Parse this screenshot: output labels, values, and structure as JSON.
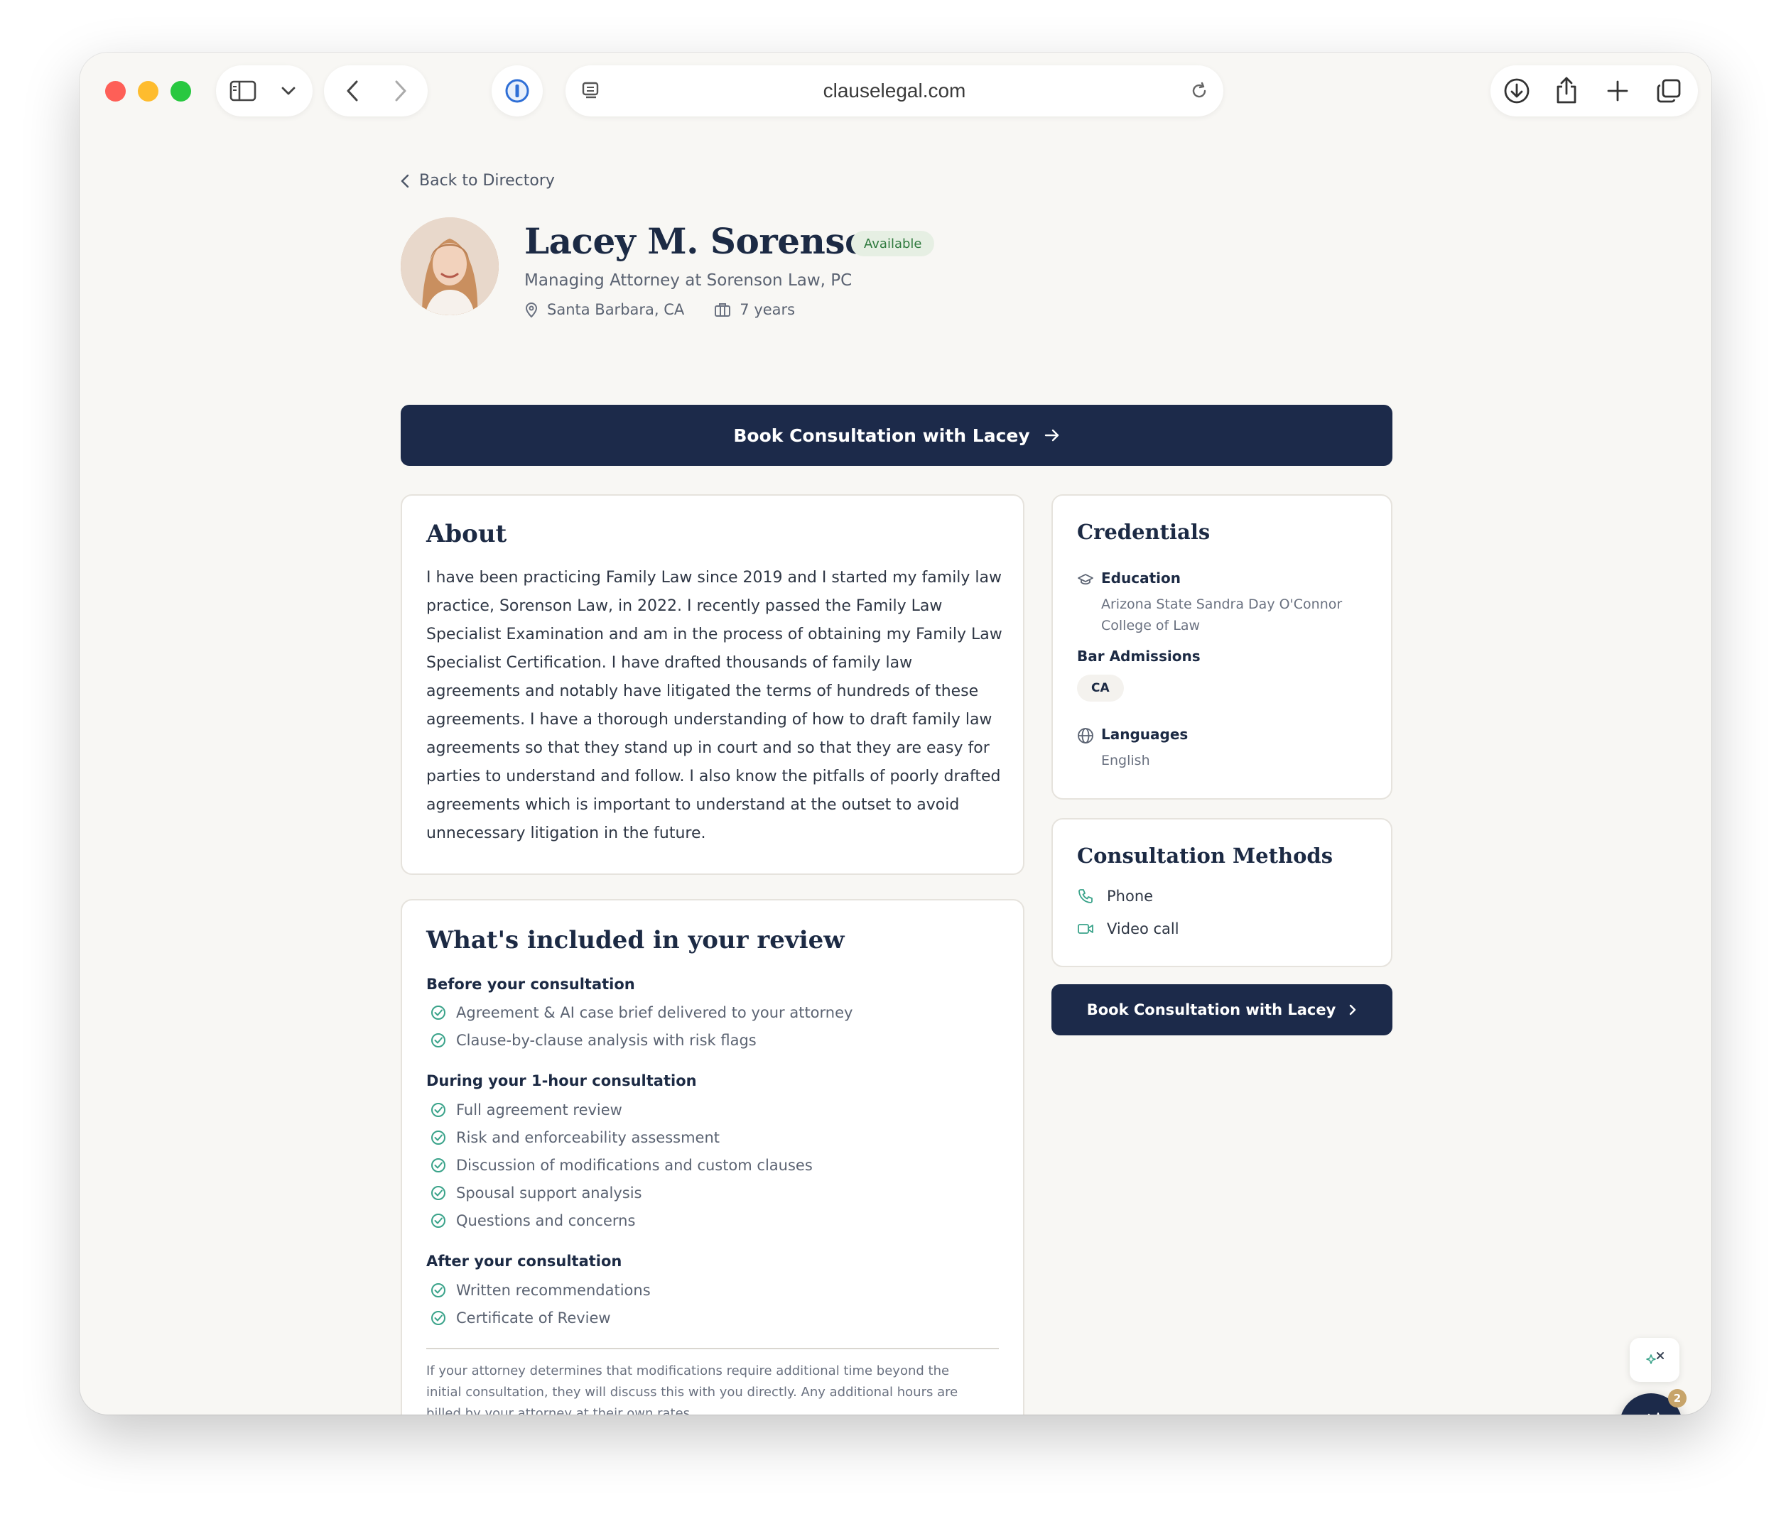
{
  "browser": {
    "url": "clauselegal.com"
  },
  "nav": {
    "back_label": "Back to Directory"
  },
  "profile": {
    "name": "Lacey M. Sorenson",
    "status": "Available",
    "title": "Managing Attorney at Sorenson Law, PC",
    "location": "Santa Barbara, CA",
    "experience": "7 years"
  },
  "cta": {
    "primary_label": "Book Consultation with Lacey",
    "secondary_label": "Book Consultation with Lacey"
  },
  "about": {
    "heading": "About",
    "lines": [
      "I have been practicing Family Law since 2019 and I started my family law",
      "practice, Sorenson Law, in 2022. I recently passed the Family Law",
      "Specialist Examination and am in the process of obtaining my Family Law",
      "Specialist Certification. I have drafted thousands of family law",
      "agreements and notably have litigated the terms of hundreds of these",
      "agreements. I have a thorough understanding of how to draft family law",
      "agreements so that they stand up in court and so that they are easy for",
      "parties to understand and follow. I also know the pitfalls of poorly drafted",
      "agreements which is important to understand at the outset to avoid",
      "unnecessary litigation in the future."
    ]
  },
  "review": {
    "heading": "What's included in your review",
    "before": {
      "heading": "Before your consultation",
      "items": [
        "Agreement & AI case brief delivered to your attorney",
        "Clause-by-clause analysis with risk flags"
      ]
    },
    "during": {
      "heading": "During your 1-hour consultation",
      "items": [
        "Full agreement review",
        "Risk and enforceability assessment",
        "Discussion of modifications and custom clauses",
        "Spousal support analysis",
        "Questions and concerns"
      ]
    },
    "after": {
      "heading": "After your consultation",
      "items": [
        "Written recommendations",
        "Certificate of Review"
      ]
    },
    "footnote_lines": [
      "If your attorney determines that modifications require additional time beyond the",
      "initial consultation, they will discuss this with you directly. Any additional hours are",
      "billed by your attorney at their own rates."
    ]
  },
  "credentials": {
    "heading": "Credentials",
    "education_label": "Education",
    "education_lines": [
      "Arizona State Sandra Day O'Connor",
      "College of Law"
    ],
    "bar_label": "Bar Admissions",
    "bar_value": "CA",
    "languages_label": "Languages",
    "languages_value": "English"
  },
  "methods": {
    "heading": "Consultation Methods",
    "phone": "Phone",
    "video": "Video call"
  },
  "assistant": {
    "badge_count": "2"
  },
  "colors": {
    "navy": "#1c2a4a",
    "available_green": "#2f7a3e",
    "check_green": "#3aa38a",
    "badge_gold": "#c7a46a"
  }
}
